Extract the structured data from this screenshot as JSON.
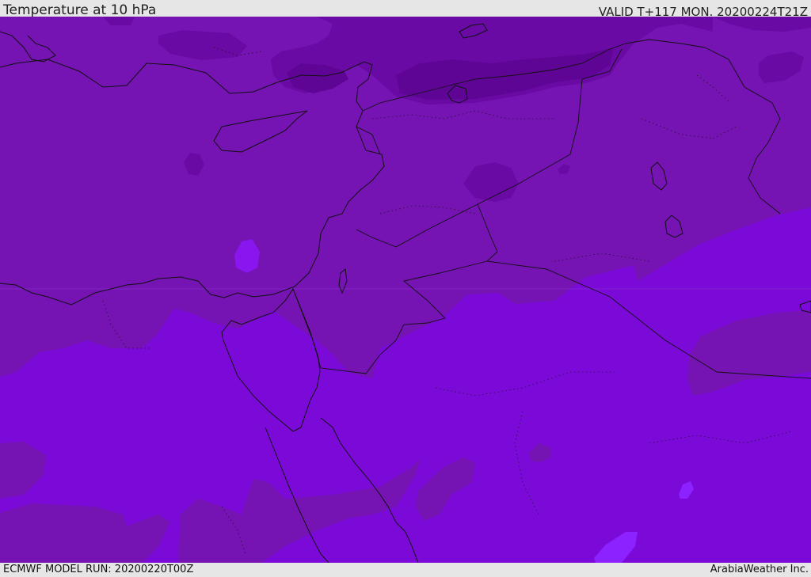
{
  "header": {
    "title": "Temperature at 10 hPa",
    "valid_time": "VALID T+117 MON. 20200224T21Z"
  },
  "footer": {
    "model_run": "ECMWF MODEL RUN: 20200220T00Z",
    "credit": "ArabiaWeather Inc."
  },
  "map": {
    "field": "Temperature",
    "level": "10 hPa",
    "colors": {
      "band_warm": "#7b0ad8",
      "band_mid": "#7513b3",
      "band_cool": "#6a0aa4",
      "band_cold": "#5f0596",
      "patch_light": "#8a16ef",
      "patch_bright": "#8b22ff",
      "coastline": "#111111"
    }
  }
}
